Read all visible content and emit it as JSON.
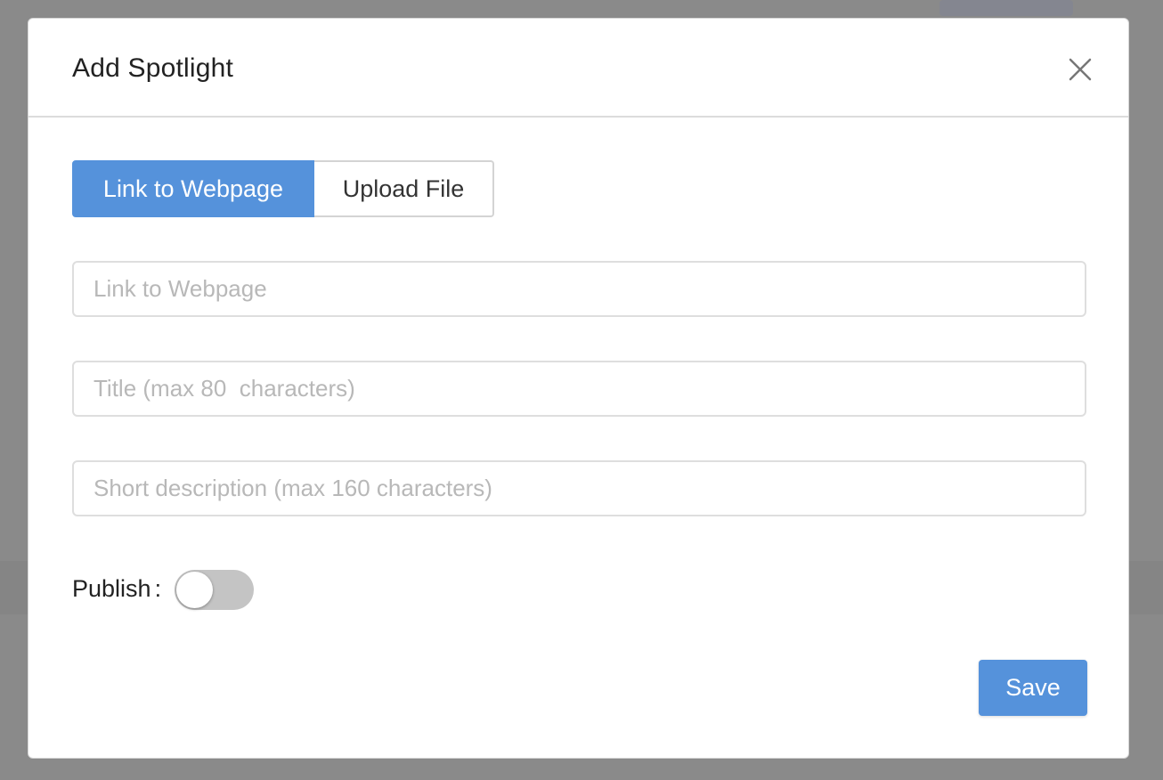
{
  "modal": {
    "title": "Add Spotlight",
    "close_icon": "close-icon"
  },
  "tabs": [
    {
      "label": "Link to Webpage",
      "active": true
    },
    {
      "label": "Upload File",
      "active": false
    }
  ],
  "fields": {
    "link": {
      "placeholder": "Link to Webpage",
      "value": ""
    },
    "title": {
      "placeholder": "Title (max 80  characters)",
      "value": ""
    },
    "description": {
      "placeholder": "Short description (max 160 characters)",
      "value": ""
    }
  },
  "publish": {
    "label": "Publish",
    "separator": ":",
    "enabled": false
  },
  "actions": {
    "save_label": "Save"
  },
  "colors": {
    "accent": "#5592db",
    "toggle_off": "#c4c4c4",
    "overlay": "#8a8a8a"
  }
}
